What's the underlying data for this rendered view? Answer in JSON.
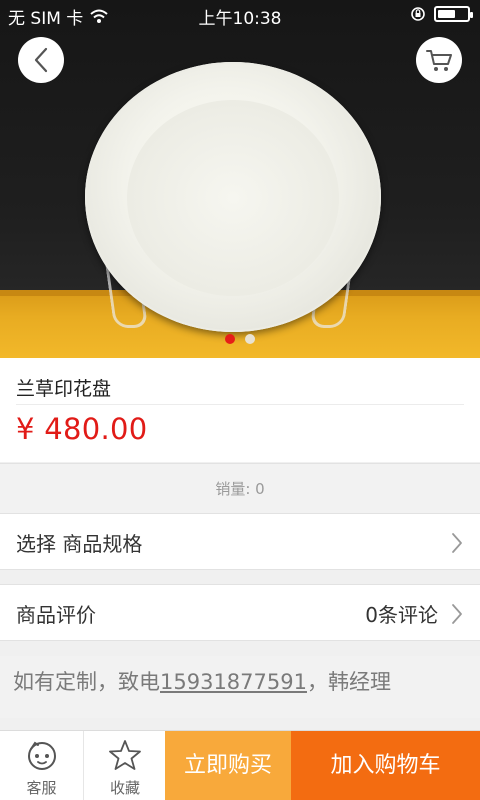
{
  "status_bar": {
    "carrier": "无 SIM 卡",
    "time": "上午10:38",
    "battery_level": 0.6
  },
  "header": {
    "back_icon": "chevron-left-icon",
    "cart_icon": "shopping-cart-icon"
  },
  "gallery": {
    "image_count": 2,
    "active_index": 0
  },
  "product": {
    "title": "兰草印花盘",
    "price": "¥ 480.00",
    "sales": "销量: 0"
  },
  "spec_row": {
    "label": "选择 商品规格"
  },
  "review_row": {
    "label": "商品评价",
    "count_text": "0条评论"
  },
  "contact": {
    "prefix": "如有定制，致电",
    "phone": "15931877591",
    "suffix": "，韩经理"
  },
  "bottom_bar": {
    "service_label": "客服",
    "favorite_label": "收藏",
    "buy_now_label": "立即购买",
    "add_to_cart_label": "加入购物车"
  },
  "colors": {
    "price": "#e11b17",
    "buy_now": "#f8a93b",
    "add_to_cart": "#f36c11",
    "dot_active": "#e61e18"
  }
}
